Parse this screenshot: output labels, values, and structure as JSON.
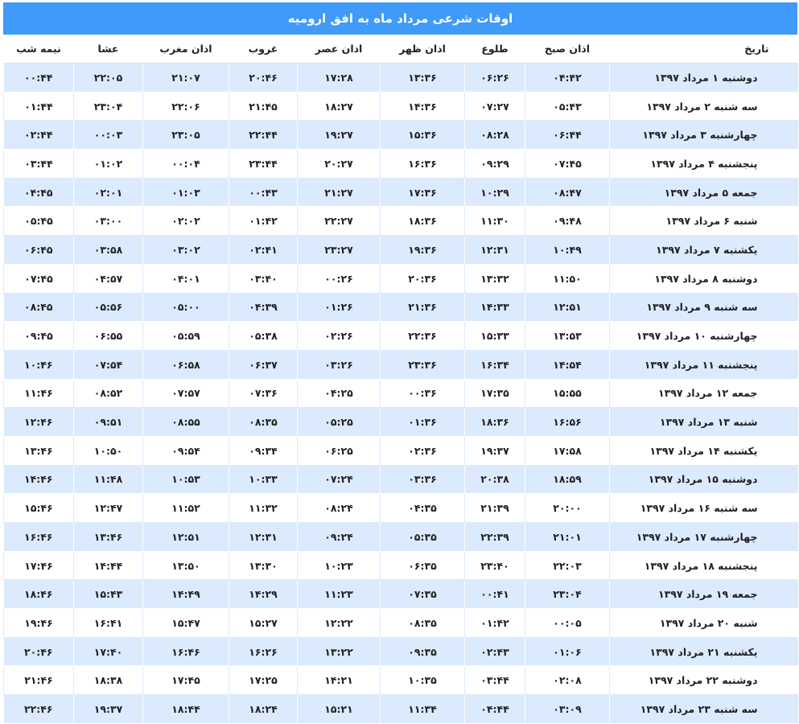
{
  "title": "اوقات شرعی مرداد ماه به افق ارومیه",
  "headers": [
    "تاریخ",
    "اذان صبح",
    "طلوع",
    "اذان ظهر",
    "اذان عصر",
    "غروب",
    "اذان مغرب",
    "عشا",
    "نیمه شب"
  ],
  "rows": [
    [
      "دوشنبه ۱ مرداد ۱۳۹۷",
      "۰۴:۴۲",
      "۰۶:۲۶",
      "۱۳:۳۶",
      "۱۷:۲۸",
      "۲۰:۴۶",
      "۲۱:۰۷",
      "۲۲:۰۵",
      "۰۰:۴۴"
    ],
    [
      "سه شنبه ۲ مرداد ۱۳۹۷",
      "۰۵:۴۳",
      "۰۷:۲۷",
      "۱۴:۳۶",
      "۱۸:۲۷",
      "۲۱:۴۵",
      "۲۲:۰۶",
      "۲۳:۰۴",
      "۰۱:۴۴"
    ],
    [
      "چهارشنبه ۳ مرداد ۱۳۹۷",
      "۰۶:۴۴",
      "۰۸:۲۸",
      "۱۵:۳۶",
      "۱۹:۲۷",
      "۲۲:۴۴",
      "۲۳:۰۵",
      "۰۰:۰۳",
      "۰۲:۴۴"
    ],
    [
      "پنجشنبه ۴ مرداد ۱۳۹۷",
      "۰۷:۴۵",
      "۰۹:۲۹",
      "۱۶:۳۶",
      "۲۰:۲۷",
      "۲۳:۴۴",
      "۰۰:۰۴",
      "۰۱:۰۲",
      "۰۳:۴۴"
    ],
    [
      "جمعه ۵ مرداد ۱۳۹۷",
      "۰۸:۴۷",
      "۱۰:۲۹",
      "۱۷:۳۶",
      "۲۱:۲۷",
      "۰۰:۴۳",
      "۰۱:۰۳",
      "۰۲:۰۱",
      "۰۴:۴۵"
    ],
    [
      "شنبه ۶ مرداد ۱۳۹۷",
      "۰۹:۴۸",
      "۱۱:۳۰",
      "۱۸:۳۶",
      "۲۲:۲۷",
      "۰۱:۴۲",
      "۰۲:۰۲",
      "۰۳:۰۰",
      "۰۵:۴۵"
    ],
    [
      "یکشنبه ۷ مرداد ۱۳۹۷",
      "۱۰:۴۹",
      "۱۲:۳۱",
      "۱۹:۳۶",
      "۲۳:۲۷",
      "۰۲:۴۱",
      "۰۳:۰۲",
      "۰۳:۵۸",
      "۰۶:۴۵"
    ],
    [
      "دوشنبه ۸ مرداد ۱۳۹۷",
      "۱۱:۵۰",
      "۱۳:۳۲",
      "۲۰:۳۶",
      "۰۰:۲۶",
      "۰۳:۴۰",
      "۰۴:۰۱",
      "۰۴:۵۷",
      "۰۷:۴۵"
    ],
    [
      "سه شنبه ۹ مرداد ۱۳۹۷",
      "۱۲:۵۱",
      "۱۴:۳۳",
      "۲۱:۳۶",
      "۰۱:۲۶",
      "۰۴:۳۹",
      "۰۵:۰۰",
      "۰۵:۵۶",
      "۰۸:۴۵"
    ],
    [
      "چهارشنبه ۱۰ مرداد ۱۳۹۷",
      "۱۳:۵۳",
      "۱۵:۳۳",
      "۲۲:۳۶",
      "۰۲:۲۶",
      "۰۵:۳۸",
      "۰۵:۵۹",
      "۰۶:۵۵",
      "۰۹:۴۵"
    ],
    [
      "پنجشنبه ۱۱ مرداد ۱۳۹۷",
      "۱۴:۵۴",
      "۱۶:۳۴",
      "۲۳:۳۶",
      "۰۳:۲۶",
      "۰۶:۳۷",
      "۰۶:۵۸",
      "۰۷:۵۴",
      "۱۰:۴۶"
    ],
    [
      "جمعه ۱۲ مرداد ۱۳۹۷",
      "۱۵:۵۵",
      "۱۷:۳۵",
      "۰۰:۳۶",
      "۰۴:۲۵",
      "۰۷:۳۶",
      "۰۷:۵۷",
      "۰۸:۵۲",
      "۱۱:۴۶"
    ],
    [
      "شنبه ۱۳ مرداد ۱۳۹۷",
      "۱۶:۵۶",
      "۱۸:۳۶",
      "۰۱:۳۶",
      "۰۵:۲۵",
      "۰۸:۳۵",
      "۰۸:۵۵",
      "۰۹:۵۱",
      "۱۲:۴۶"
    ],
    [
      "یکشنبه ۱۴ مرداد ۱۳۹۷",
      "۱۷:۵۸",
      "۱۹:۳۷",
      "۰۲:۳۶",
      "۰۶:۲۵",
      "۰۹:۳۴",
      "۰۹:۵۴",
      "۱۰:۵۰",
      "۱۳:۴۶"
    ],
    [
      "دوشنبه ۱۵ مرداد ۱۳۹۷",
      "۱۸:۵۹",
      "۲۰:۳۸",
      "۰۳:۳۶",
      "۰۷:۲۴",
      "۱۰:۳۳",
      "۱۰:۵۳",
      "۱۱:۴۸",
      "۱۴:۴۶"
    ],
    [
      "سه شنبه ۱۶ مرداد ۱۳۹۷",
      "۲۰:۰۰",
      "۲۱:۳۹",
      "۰۴:۳۵",
      "۰۸:۲۴",
      "۱۱:۳۲",
      "۱۱:۵۲",
      "۱۲:۴۷",
      "۱۵:۴۶"
    ],
    [
      "چهارشنبه ۱۷ مرداد ۱۳۹۷",
      "۲۱:۰۱",
      "۲۲:۳۹",
      "۰۵:۳۵",
      "۰۹:۲۴",
      "۱۲:۳۱",
      "۱۲:۵۱",
      "۱۳:۴۶",
      "۱۶:۴۶"
    ],
    [
      "پنجشنبه ۱۸ مرداد ۱۳۹۷",
      "۲۲:۰۳",
      "۲۳:۴۰",
      "۰۶:۳۵",
      "۱۰:۲۳",
      "۱۳:۳۰",
      "۱۳:۵۰",
      "۱۴:۴۴",
      "۱۷:۴۶"
    ],
    [
      "جمعه ۱۹ مرداد ۱۳۹۷",
      "۲۳:۰۴",
      "۰۰:۴۱",
      "۰۷:۳۵",
      "۱۱:۲۳",
      "۱۴:۲۹",
      "۱۴:۴۹",
      "۱۵:۴۳",
      "۱۸:۴۶"
    ],
    [
      "شنبه ۲۰ مرداد ۱۳۹۷",
      "۰۰:۰۵",
      "۰۱:۴۲",
      "۰۸:۳۵",
      "۱۲:۲۲",
      "۱۵:۲۷",
      "۱۵:۴۷",
      "۱۶:۴۱",
      "۱۹:۴۶"
    ],
    [
      "یکشنبه ۲۱ مرداد ۱۳۹۷",
      "۰۱:۰۶",
      "۰۲:۴۳",
      "۰۹:۳۵",
      "۱۳:۲۲",
      "۱۶:۲۶",
      "۱۶:۴۶",
      "۱۷:۴۰",
      "۲۰:۴۶"
    ],
    [
      "دوشنبه ۲۲ مرداد ۱۳۹۷",
      "۰۲:۰۸",
      "۰۳:۴۴",
      "۱۰:۳۵",
      "۱۴:۲۱",
      "۱۷:۲۵",
      "۱۷:۴۵",
      "۱۸:۳۸",
      "۲۱:۴۶"
    ],
    [
      "سه شنبه ۲۳ مرداد ۱۳۹۷",
      "۰۳:۰۹",
      "۰۴:۴۴",
      "۱۱:۳۴",
      "۱۵:۲۱",
      "۱۸:۲۴",
      "۱۸:۴۴",
      "۱۹:۳۷",
      "۲۲:۴۶"
    ]
  ],
  "colors": {
    "title_bg": "#3f9af9",
    "row_alt": "#dbeafd"
  }
}
